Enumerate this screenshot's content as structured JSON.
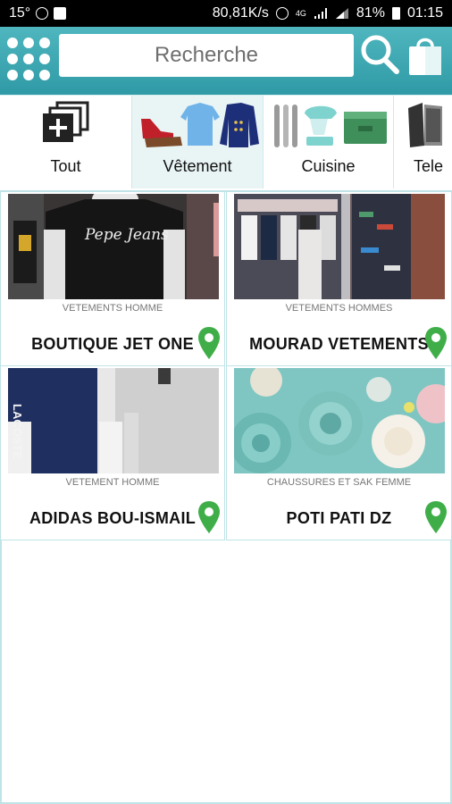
{
  "status_bar": {
    "left_text": "15°",
    "network_speed": "80,81K/s",
    "battery": "81%",
    "time": "01:15",
    "network_type": "4G"
  },
  "search": {
    "placeholder": "Recherche"
  },
  "categories": [
    {
      "label": "Tout",
      "icon": "add-list-icon"
    },
    {
      "label": "Vêtement",
      "icon": "clothing-icon",
      "active": true
    },
    {
      "label": "Cuisine",
      "icon": "kitchen-icon"
    },
    {
      "label": "Tele",
      "icon": "phone-icon"
    }
  ],
  "shops": [
    {
      "category": "VETEMENTS HOMME",
      "name": "BOUTIQUE JET ONE",
      "thumb_text": "Pepe Jeans"
    },
    {
      "category": "VETEMENTS HOMMES",
      "name": "MOURAD VETEMENTS"
    },
    {
      "category": "VETEMENT HOMME",
      "name": "ADIDAS BOU-ISMAIL",
      "thumb_text": "LACOSTE"
    },
    {
      "category": "CHAUSSURES ET SAK FEMME",
      "name": "POTI PATI DZ"
    }
  ],
  "colors": {
    "header": "#2f9aa6",
    "accent": "#4fb6be",
    "pin": "#3fae49",
    "border": "#bfe3e6"
  }
}
